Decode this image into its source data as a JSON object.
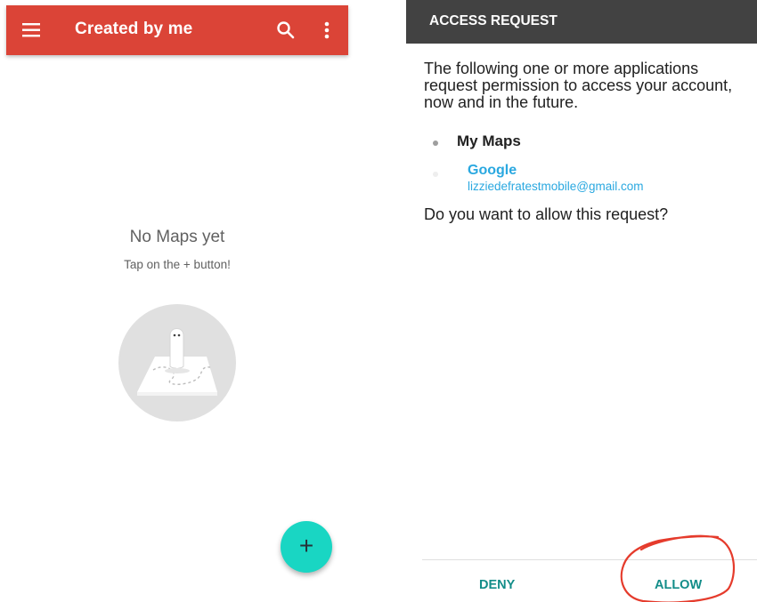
{
  "left": {
    "app_bar": {
      "title": "Created by me",
      "color": "#db4437",
      "icons": [
        "menu-icon",
        "search-icon",
        "more-vert-icon"
      ]
    },
    "empty_state": {
      "title": "No Maps yet",
      "subtitle": "Tap on the + button!",
      "illustration": "ghost-on-map-illustration"
    },
    "fab": {
      "label": "+",
      "color": "#19d6c3"
    }
  },
  "right": {
    "header": {
      "title": "ACCESS REQUEST",
      "color": "#424242"
    },
    "message": "The following one or more applications request permission to access your account, now and in the future.",
    "app_name": "My Maps",
    "account": {
      "provider": "Google",
      "email": "lizziedefratestmobile@gmail.com"
    },
    "question": "Do you want to allow this request?",
    "buttons": {
      "deny": "DENY",
      "allow": "ALLOW"
    },
    "accent": "#138d89",
    "annotation": "red-hand-drawn-circle-around-allow"
  }
}
